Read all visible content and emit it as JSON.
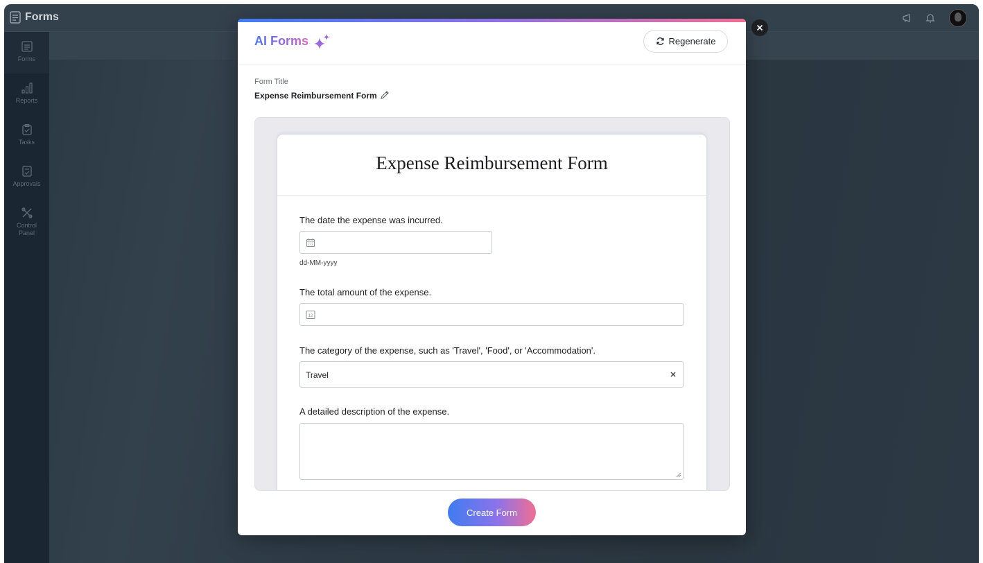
{
  "app": {
    "name": "Forms"
  },
  "sidebar": {
    "items": [
      {
        "label": "Forms",
        "icon": "forms-icon"
      },
      {
        "label": "Reports",
        "icon": "reports-icon"
      },
      {
        "label": "Tasks",
        "icon": "tasks-icon"
      },
      {
        "label": "Approvals",
        "icon": "approvals-icon"
      },
      {
        "label_line1": "Control",
        "label_line2": "Panel",
        "icon": "control-panel-icon"
      }
    ]
  },
  "modal": {
    "title": "AI Forms",
    "regenerate_label": "Regenerate",
    "form_title_label": "Form Title",
    "form_title_value": "Expense Reimbursement Form",
    "create_label": "Create Form",
    "colors": {
      "accent_start": "#3f7cf0",
      "accent_mid": "#8c6fe6",
      "accent_end": "#ef6e93"
    }
  },
  "preview": {
    "title": "Expense Reimbursement Form",
    "fields": [
      {
        "label": "The date the expense was incurred.",
        "type": "date",
        "hint": "dd-MM-yyyy",
        "icon": "calendar-icon"
      },
      {
        "label": "The total amount of the expense.",
        "type": "number",
        "icon": "number-icon"
      },
      {
        "label": "The category of the expense, such as 'Travel', 'Food', or 'Accommodation'.",
        "type": "select",
        "value": "Travel"
      },
      {
        "label": "A detailed description of the expense.",
        "type": "textarea"
      }
    ]
  }
}
